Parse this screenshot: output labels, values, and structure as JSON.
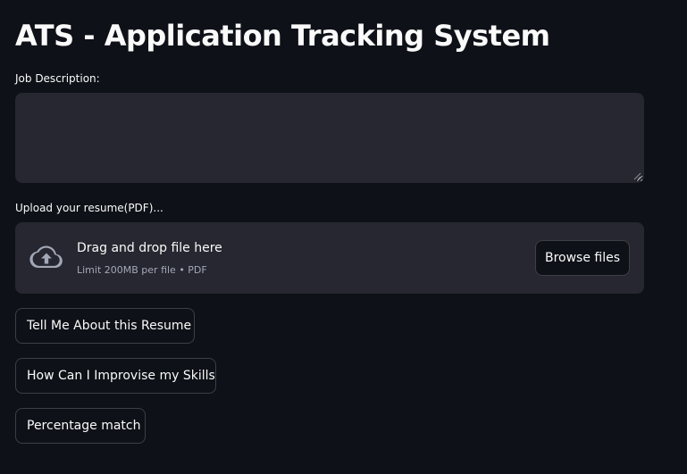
{
  "page": {
    "title": "ATS - Application Tracking System"
  },
  "job_description": {
    "label": "Job Description:",
    "value": ""
  },
  "uploader": {
    "label": "Upload your resume(PDF)...",
    "drop_text": "Drag and drop file here",
    "limit_text": "Limit 200MB per file • PDF",
    "browse_label": "Browse files",
    "icon": "cloud-upload-icon"
  },
  "actions": {
    "tell_me_label": "Tell Me About this Resume",
    "improve_label": "How Can I Improvise my Skills",
    "match_label": "Percentage match"
  },
  "colors": {
    "background": "#0e1117",
    "input_background": "#262730",
    "text": "#fafafa",
    "muted_text": "#a3a8b8"
  }
}
